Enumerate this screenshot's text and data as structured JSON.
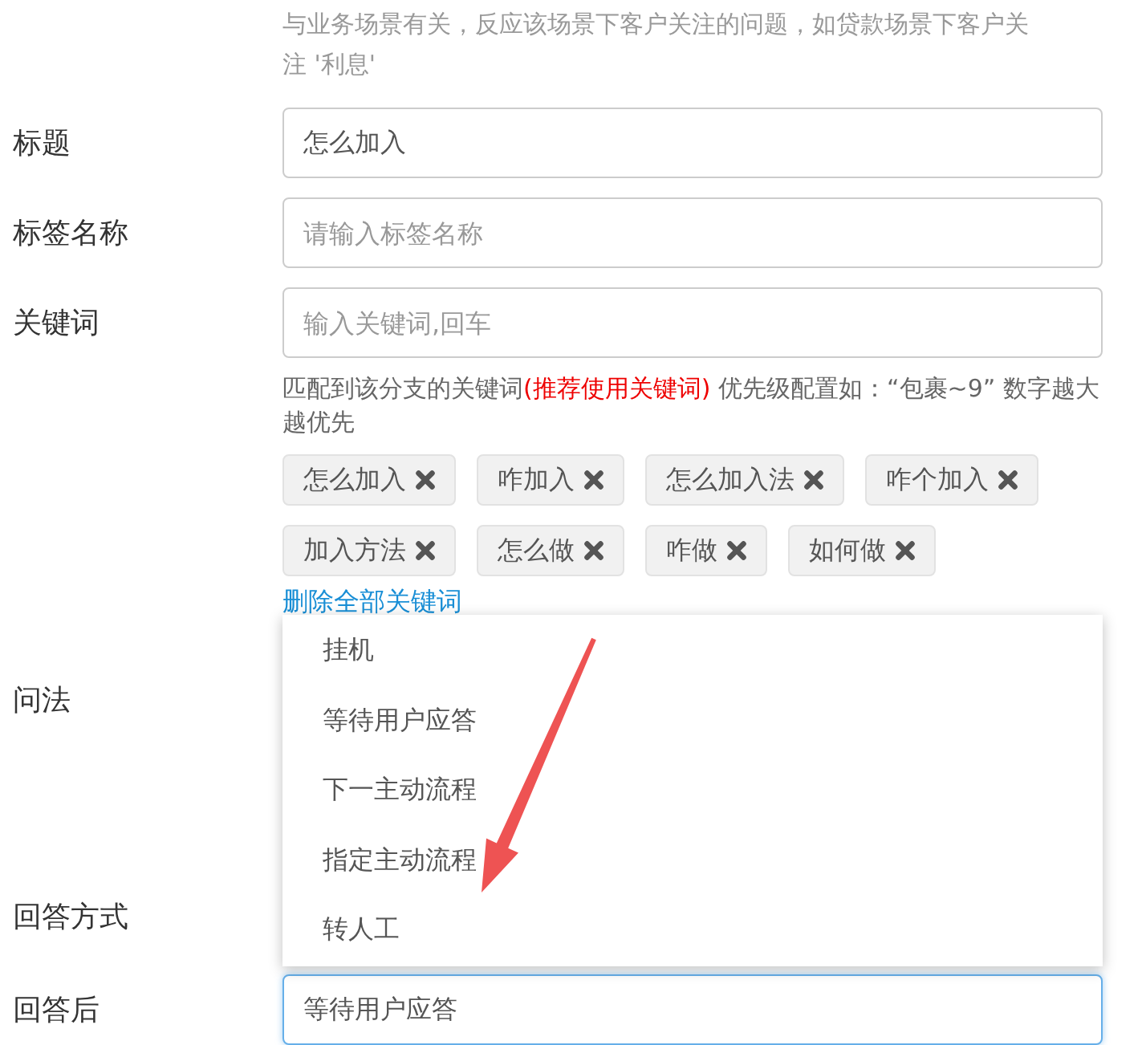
{
  "help_text": "与业务场景有关，反应该场景下客户关注的问题，如贷款场景下客户关注 '利息'",
  "fields": [
    {
      "label": "标题",
      "value": "怎么加入"
    },
    {
      "label": "标签名称",
      "placeholder": "请输入标签名称"
    },
    {
      "label": "关键词",
      "placeholder": "输入关键词,回车"
    }
  ],
  "keyword_hint": [
    {
      "kind": "normal",
      "text": "匹配到该分支的关键词"
    },
    {
      "kind": "emphasis",
      "text": "(推荐使用关键词)"
    },
    {
      "kind": "normal",
      "text": " 优先级配置如：“包裹~9” 数字越大越优先"
    }
  ],
  "keyword_tags": [
    "怎么加入",
    "咋加入",
    "怎么加入法",
    "咋个加入",
    "加入方法",
    "怎么做",
    "咋做",
    "如何做"
  ],
  "remove_all_link": "删除全部关键词",
  "question_label": "问法",
  "answer_mode_label": "回答方式",
  "after_answer": {
    "label": "回答后",
    "value": "等待用户应答",
    "focused": true
  },
  "dropdown": {
    "options": [
      "挂机",
      "等待用户应答",
      "下一主动流程",
      "指定主动流程",
      "转人工"
    ]
  }
}
